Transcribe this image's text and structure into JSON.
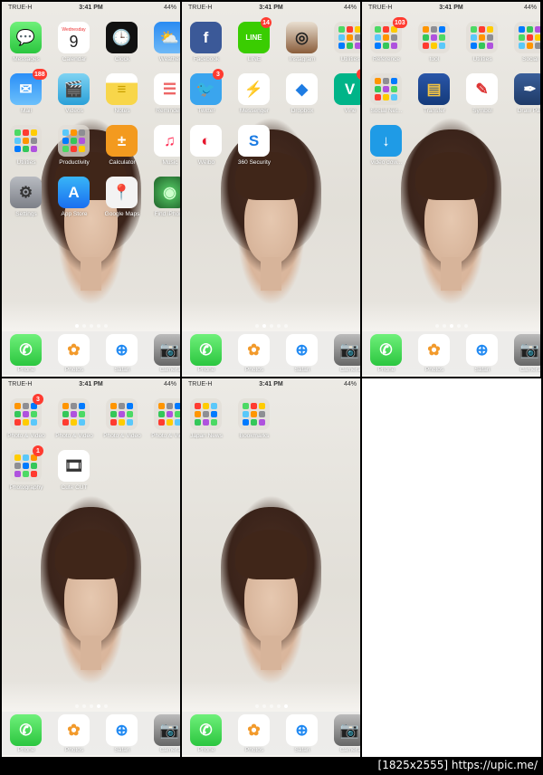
{
  "status": {
    "carrier": "TRUE-H",
    "time": "3:41 PM",
    "battery": "44%"
  },
  "screens": [
    {
      "apps": [
        {
          "label": "Messages"
        },
        {
          "label": "Calendar",
          "day": "Wednesday",
          "date": "9"
        },
        {
          "label": "Clock"
        },
        {
          "label": "Weather"
        },
        {
          "label": "Mail",
          "badge": "188"
        },
        {
          "label": "Videos"
        },
        {
          "label": "Notes"
        },
        {
          "label": "Reminders"
        },
        {
          "label": "Utilities"
        },
        {
          "label": "Productivity"
        },
        {
          "label": "Calculator"
        },
        {
          "label": "Music"
        },
        {
          "label": "Settings"
        },
        {
          "label": "App Store"
        },
        {
          "label": "Google Maps"
        },
        {
          "label": "Find iPhone"
        }
      ]
    },
    {
      "apps": [
        {
          "label": "Facebook"
        },
        {
          "label": "LINE",
          "badge": "14"
        },
        {
          "label": "Instagram"
        },
        {
          "label": "Utilities"
        },
        {
          "label": "Twitter",
          "badge": "3"
        },
        {
          "label": "Messenger"
        },
        {
          "label": "Dropbox"
        },
        {
          "label": "Vine",
          "badge": "1"
        },
        {
          "label": "Weibo"
        },
        {
          "label": "360 Security"
        }
      ]
    },
    {
      "apps": [
        {
          "label": "Reference",
          "badge": "103"
        },
        {
          "label": "tool"
        },
        {
          "label": "Utilities"
        },
        {
          "label": "Social"
        },
        {
          "label": "Social Net..."
        },
        {
          "label": "Transfer"
        },
        {
          "label": "Symbol"
        },
        {
          "label": "Draw Pad"
        },
        {
          "label": "video dow..."
        }
      ]
    },
    {
      "apps": [
        {
          "label": "Photo & Video",
          "badge": "3"
        },
        {
          "label": "Photo & Video"
        },
        {
          "label": "Photo & Video"
        },
        {
          "label": "Photo & Video"
        },
        {
          "label": "Photography",
          "badge": "1"
        },
        {
          "label": "Cute CUT"
        }
      ]
    },
    {
      "apps": [
        {
          "label": "Japan News"
        },
        {
          "label": "Bookmarks"
        }
      ]
    }
  ],
  "dock": [
    {
      "label": "Phone"
    },
    {
      "label": "Photos"
    },
    {
      "label": "Safari"
    },
    {
      "label": "Camera"
    }
  ],
  "watermark": "[1825x2555] https://upic.me/"
}
